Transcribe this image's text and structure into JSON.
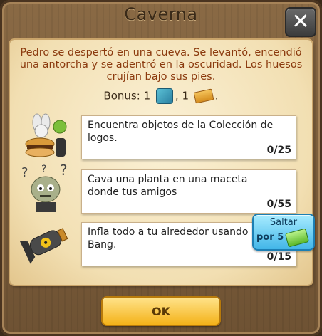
{
  "dialog": {
    "title": "Caverna",
    "close_label": "✕",
    "description": "Pedro se despertó en una cueva. Se levantó, encendió una antorcha y se adentró en la oscuridad. Los huesos crujían bajo sus pies.",
    "bonus_label": "Bonus:",
    "bonus_qty_1": "1",
    "bonus_sep": ",",
    "bonus_qty_2": "1",
    "bonus_end": "."
  },
  "tasks": [
    {
      "text": "Encuentra objetos de la Colección de logos.",
      "progress": "0/25",
      "icon": "collection-items-icon"
    },
    {
      "text": "Cava una planta en una maceta donde tus amigos",
      "progress": "0/55",
      "icon": "zombie-icon"
    },
    {
      "text": "Infla todo a tu alrededor usando los Bang.",
      "progress": "0/15",
      "icon": "bang-bomb-icon"
    }
  ],
  "skip": {
    "label": "Saltar",
    "cost_prefix": "por",
    "cost": "5"
  },
  "buttons": {
    "ok_label": "OK"
  }
}
